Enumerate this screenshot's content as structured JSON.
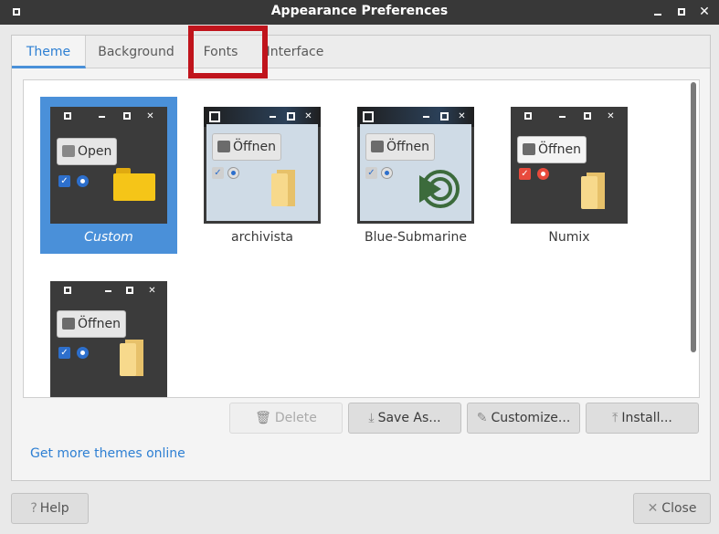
{
  "window": {
    "title": "Appearance Preferences"
  },
  "tabs": [
    {
      "label": "Theme"
    },
    {
      "label": "Background"
    },
    {
      "label": "Fonts"
    },
    {
      "label": "Interface"
    }
  ],
  "themes": [
    {
      "name": "Custom",
      "button": "Open",
      "selected": true
    },
    {
      "name": "archivista",
      "button": "Öffnen"
    },
    {
      "name": "Blue-Submarine",
      "button": "Öffnen"
    },
    {
      "name": "Numix",
      "button": "Öffnen"
    },
    {
      "name": "",
      "button": "Öffnen"
    }
  ],
  "actions": {
    "delete": "Delete",
    "save_as": "Save As...",
    "customize": "Customize...",
    "install": "Install..."
  },
  "link": "Get more themes online",
  "footer": {
    "help": "Help",
    "close": "Close"
  },
  "colors": {
    "accent": "#4a90d9",
    "highlight_box": "#c0141c",
    "titlebar": "#383838"
  }
}
